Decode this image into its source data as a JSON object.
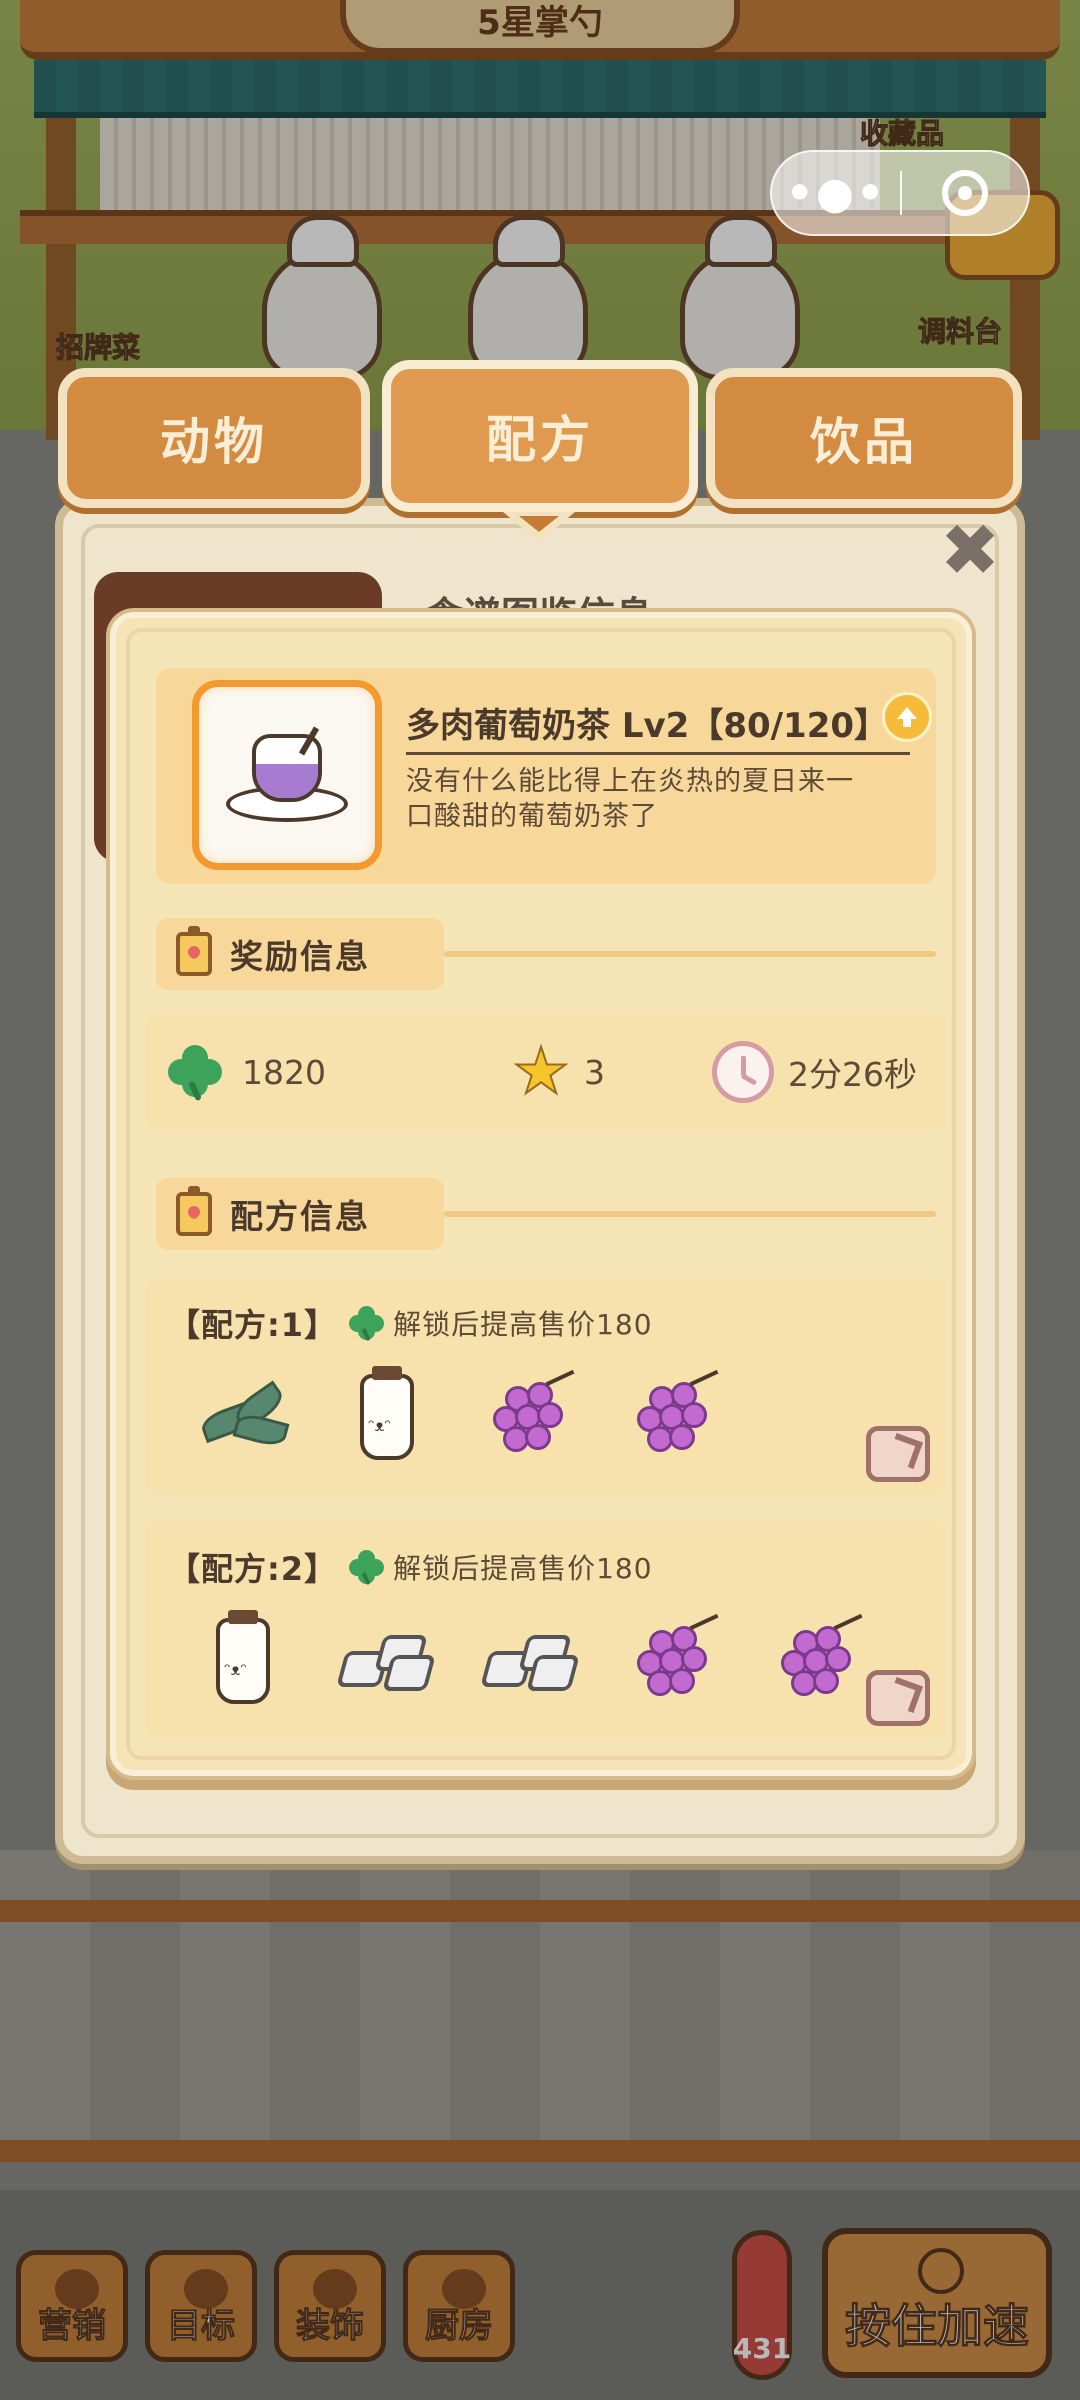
{
  "scene": {
    "shop_sign": "5星掌勺",
    "signature_dish_label": "招牌菜",
    "collection_label": "收藏品",
    "seasoning_label": "调料台"
  },
  "tabs": [
    {
      "label": "动物",
      "active": false
    },
    {
      "label": "配方",
      "active": true
    },
    {
      "label": "饮品",
      "active": false
    }
  ],
  "panel": {
    "background_title": "食谱图鉴信息",
    "close_icon": "close-icon"
  },
  "item": {
    "name": "多肉葡萄奶茶 Lv2【80/120】",
    "description": "没有什么能比得上在炎热的夏日来一口酸甜的葡萄奶茶了",
    "icon": "grape-milk-tea-icon",
    "upgrade_icon": "upgrade-arrow-icon"
  },
  "reward_section": {
    "title": "奖励信息",
    "clover_value": "1820",
    "star_value": "3",
    "time_value": "2分26秒"
  },
  "recipe_section": {
    "title": "配方信息",
    "recipes": [
      {
        "label": "【配方:1】",
        "bonus": "解锁后提高售价180",
        "ingredients": [
          "tea-leaf-icon",
          "milk-bottle-icon",
          "grape-icon",
          "grape-icon"
        ]
      },
      {
        "label": "【配方:2】",
        "bonus": "解锁后提高售价180",
        "ingredients": [
          "milk-bottle-icon",
          "tofu-icon",
          "tofu-icon",
          "grape-icon",
          "grape-icon"
        ]
      }
    ]
  },
  "bottom_bar": {
    "buttons": [
      "营销",
      "目标",
      "装饰",
      "厨房"
    ],
    "thermometer_value": "431",
    "speed_label": "按住加速"
  },
  "colors": {
    "tab_orange": "#df9a4f",
    "dialog_bg": "#f5e4b5",
    "accent_orange": "#f29a2e",
    "clover_green": "#3da25a",
    "star_yellow": "#f5c52b"
  }
}
